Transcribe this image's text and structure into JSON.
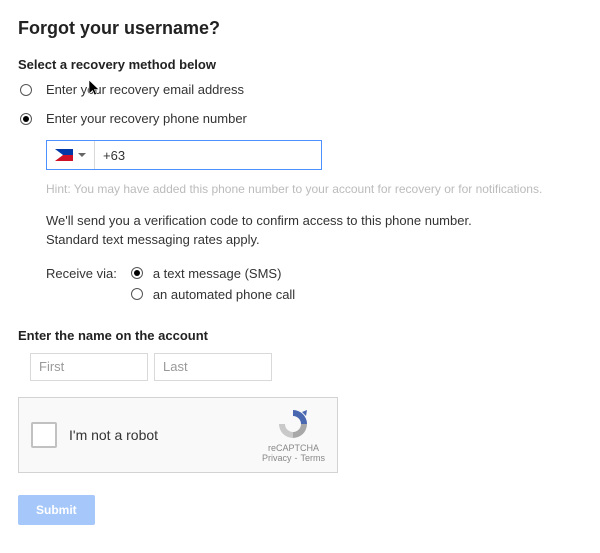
{
  "title": "Forgot your username?",
  "recovery": {
    "section_label": "Select a recovery method below",
    "options": [
      {
        "label": "Enter your recovery email address",
        "selected": false
      },
      {
        "label": "Enter your recovery phone number",
        "selected": true
      }
    ]
  },
  "phone": {
    "country_code": "+63",
    "country": "Philippines",
    "hint": "Hint: You may have added this phone number to your account for recovery or for notifications.",
    "info_line1": "We'll send you a verification code to confirm access to this phone number.",
    "info_line2": "Standard text messaging rates apply."
  },
  "receive": {
    "label": "Receive via:",
    "options": [
      {
        "label": "a text message (SMS)",
        "selected": true
      },
      {
        "label": "an automated phone call",
        "selected": false
      }
    ]
  },
  "name": {
    "section_label": "Enter the name on the account",
    "first_placeholder": "First",
    "last_placeholder": "Last"
  },
  "recaptcha": {
    "label": "I'm not a robot",
    "brand": "reCAPTCHA",
    "privacy": "Privacy",
    "terms": "Terms"
  },
  "submit_label": "Submit"
}
